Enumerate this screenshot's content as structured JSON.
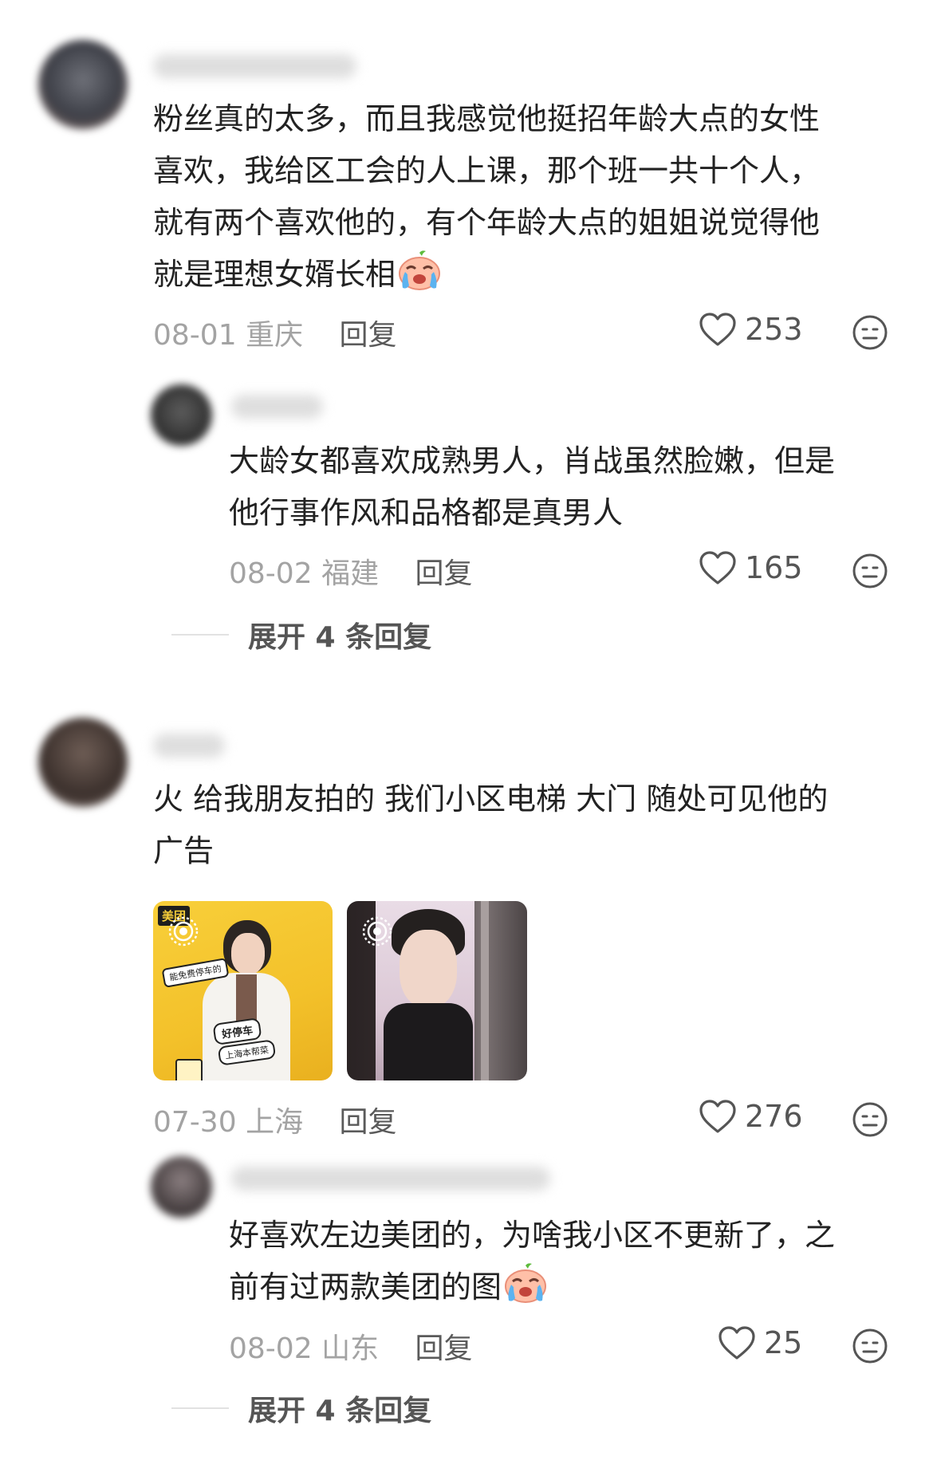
{
  "comments": [
    {
      "text_lines": [
        "粉丝真的太多，而且我感觉他挺招年龄大点的女性",
        "喜欢，我给区工会的人上课，那个班一共十个人，",
        "就有两个喜欢他的，有个年龄大点的姐姐说觉得他",
        "就是理想女婿长相"
      ],
      "date": "08-01",
      "location": "重庆",
      "reply_label": "回复",
      "likes": "253",
      "reply": {
        "text_lines": [
          "大龄女都喜欢成熟男人，肖战虽然脸嫩，但是",
          "他行事作风和品格都是真男人"
        ],
        "date": "08-02",
        "location": "福建",
        "reply_label": "回复",
        "likes": "165"
      },
      "expand_label": "展开 4 条回复"
    },
    {
      "text_lines": [
        "火  给我朋友拍的 我们小区电梯 大门 随处可见他的",
        "广告"
      ],
      "images": [
        {
          "brand_text": "美团",
          "poster_text": [
            "能免费停车的",
            "好停车",
            "上海本帮菜"
          ]
        },
        {
          "brand_text": ""
        }
      ],
      "date": "07-30",
      "location": "上海",
      "reply_label": "回复",
      "likes": "276",
      "reply": {
        "text_lines": [
          "好喜欢左边美团的，为啥我小区不更新了，之",
          "前有过两款美团的图"
        ],
        "date": "08-02",
        "location": "山东",
        "reply_label": "回复",
        "likes": "25"
      },
      "expand_label": "展开 4 条回复"
    }
  ],
  "icons": {
    "like": "heart-outline-icon",
    "more": "neutral-face-icon",
    "emoji": "crying-face-emoji",
    "live": "live-photo-icon"
  },
  "colors": {
    "text": "#222222",
    "meta": "#a3a3a3",
    "reply": "#5a5a5a",
    "brand_yellow": "#f7c531"
  }
}
